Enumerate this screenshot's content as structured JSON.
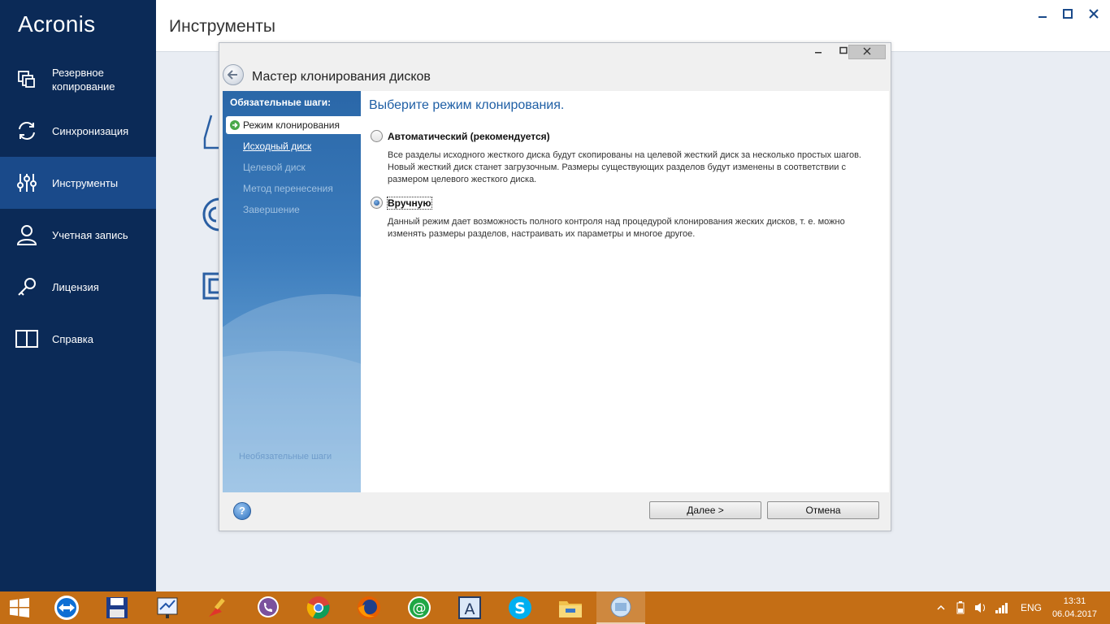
{
  "app": {
    "logo": "Acronis"
  },
  "sidebar": {
    "items": [
      {
        "label": "Резервное\nкопирование",
        "icon": "backup-icon"
      },
      {
        "label": "Синхронизация",
        "icon": "sync-icon"
      },
      {
        "label": "Инструменты",
        "icon": "tools-icon",
        "active": true
      },
      {
        "label": "Учетная запись",
        "icon": "account-icon"
      },
      {
        "label": "Лицензия",
        "icon": "key-icon"
      },
      {
        "label": "Справка",
        "icon": "book-icon"
      }
    ]
  },
  "header": {
    "title": "Инструменты"
  },
  "dialog": {
    "title": "Мастер клонирования дисков",
    "steps_heading": "Обязательные шаги:",
    "steps": [
      {
        "label": "Режим клонирования",
        "state": "current"
      },
      {
        "label": "Исходный диск",
        "state": "link"
      },
      {
        "label": "Целевой диск",
        "state": "disabled"
      },
      {
        "label": "Метод перенесения",
        "state": "disabled"
      },
      {
        "label": "Завершение",
        "state": "disabled"
      }
    ],
    "steps_footer": "Необязательные шаги",
    "content_title": "Выберите режим клонирования.",
    "options": [
      {
        "label": "Автоматический (рекомендуется)",
        "selected": false,
        "description": "Все разделы исходного жесткого диска будут скопированы на целевой жесткий диск за несколько простых шагов. Новый жесткий диск станет загрузочным. Размеры существующих разделов будут изменены в соответствии с размером целевого жесткого диска."
      },
      {
        "label": "Вручную",
        "selected": true,
        "description": "Данный режим дает возможность полного контроля над процедурой клонирования жеских дисков, т. е. можно изменять размеры разделов, настраивать их параметры и многое другое."
      }
    ],
    "next_label": "Далее >",
    "cancel_label": "Отмена"
  },
  "taskbar": {
    "apps": [
      "start",
      "teamviewer",
      "floppy-save",
      "presentation",
      "ccleaner",
      "viber",
      "chrome",
      "firefox",
      "mail-agent",
      "font-app",
      "skype",
      "file-explorer",
      "acronis-active"
    ],
    "language": "ENG",
    "time": "13:31",
    "date": "06.04.2017"
  },
  "colors": {
    "sidebar": "#0b2a57",
    "sidebar_active": "#1a4a8a",
    "taskbar": "#c46e15",
    "accent": "#1f5fa5"
  }
}
